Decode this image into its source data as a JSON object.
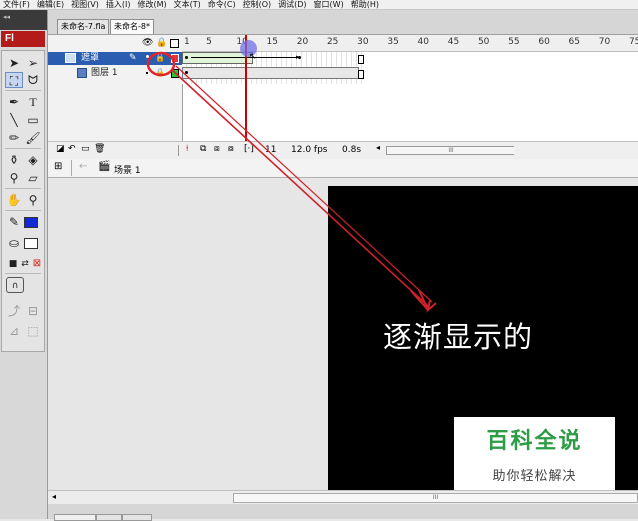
{
  "menu": [
    "文件(F)",
    "编辑(E)",
    "视图(V)",
    "插入(I)",
    "修改(M)",
    "文本(T)",
    "命令(C)",
    "控制(O)",
    "调试(D)",
    "窗口(W)",
    "帮助(H)"
  ],
  "tools": {
    "badge": "Fl"
  },
  "tabs": [
    "未命名-7.fla",
    "未命名-8*"
  ],
  "timeline": {
    "frame_numbers": [
      "1",
      "5",
      "10",
      "15",
      "20",
      "25",
      "30",
      "35",
      "40",
      "45",
      "50",
      "55",
      "60",
      "65",
      "70",
      "75"
    ],
    "layers": [
      {
        "name": "遮罩",
        "selected": true
      },
      {
        "name": "图层 1",
        "selected": false
      }
    ],
    "current_frame": "11",
    "fps": "12.0 fps",
    "time": "0.8s"
  },
  "editbar": {
    "scene": "场景 1"
  },
  "stage": {
    "text": "逐渐显示的"
  },
  "watermark": {
    "title": "百科全说",
    "subtitle": "助你轻松解决"
  },
  "colors": {
    "stage": "#000000",
    "selected_layer": "#2a5db0",
    "annotation": "#e0242c",
    "playhead": "#cc0000"
  }
}
